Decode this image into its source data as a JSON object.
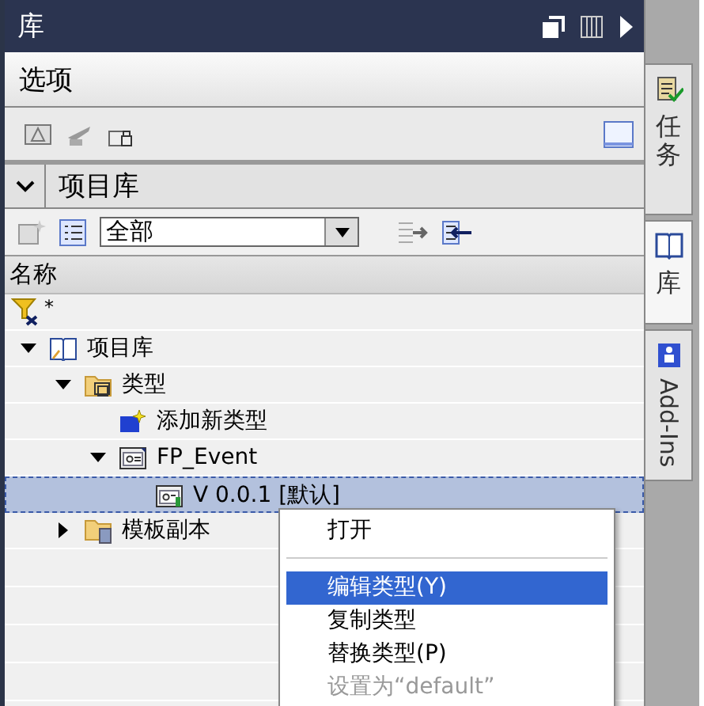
{
  "panel": {
    "title": "库"
  },
  "options": {
    "title": "选项"
  },
  "project_library": {
    "title": "项目库",
    "expanded": true,
    "filter": {
      "value": "全部"
    },
    "column": "名称",
    "name_filter": "*",
    "tree": [
      {
        "label": "项目库",
        "kind": "library",
        "expanded": true,
        "selected": false,
        "children": [
          {
            "label": "类型",
            "kind": "type-folder",
            "expanded": true,
            "selected": false,
            "children": [
              {
                "label": "添加新类型",
                "kind": "add",
                "selected": false
              },
              {
                "label": "FP_Event",
                "kind": "type",
                "expanded": true,
                "selected": false,
                "children": [
                  {
                    "label": "V 0.0.1 [默认]",
                    "kind": "version",
                    "selected": true
                  }
                ]
              }
            ]
          },
          {
            "label": "模板副本",
            "kind": "folder",
            "expanded": false,
            "selected": false
          }
        ]
      }
    ]
  },
  "context_menu": [
    {
      "kind": "item",
      "label": "打开",
      "selected": false,
      "disabled": false
    },
    {
      "kind": "separator"
    },
    {
      "kind": "item",
      "label": "编辑类型(Y)",
      "selected": true,
      "disabled": false
    },
    {
      "kind": "item",
      "label": "复制类型",
      "selected": false,
      "disabled": false
    },
    {
      "kind": "item",
      "label": "替换类型(P)",
      "selected": false,
      "disabled": false
    },
    {
      "kind": "item",
      "label": "设置为“default”",
      "selected": false,
      "disabled": true
    }
  ],
  "side_tabs": [
    {
      "kind": "tasks",
      "label": "任务",
      "selected": false
    },
    {
      "kind": "library",
      "label": "库",
      "selected": true
    },
    {
      "kind": "addins",
      "label": "Add-Ins",
      "selected": false
    }
  ]
}
